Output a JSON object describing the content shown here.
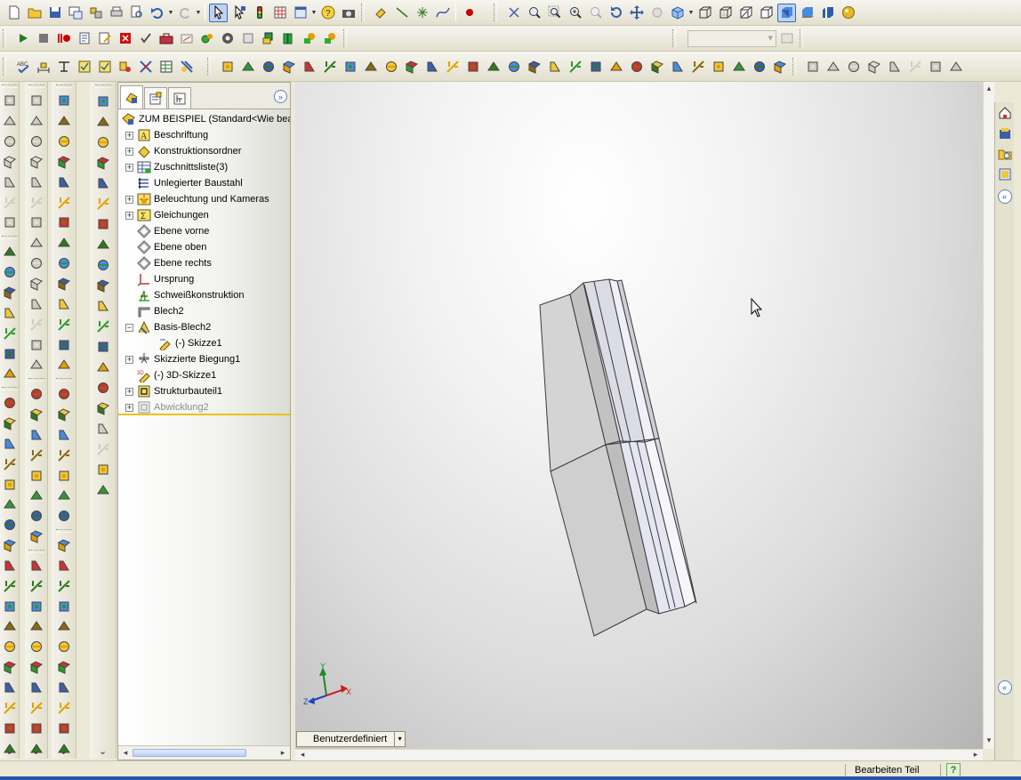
{
  "feature_tree": {
    "root": "ZUM BEISPIEL  (Standard<Wie bea",
    "items": [
      {
        "label": "Beschriftung",
        "expander": "+",
        "icon": "annotation-icon",
        "indent": 0
      },
      {
        "label": "Konstruktionsordner",
        "expander": "+",
        "icon": "design-binder-icon",
        "indent": 0
      },
      {
        "label": "Zuschnittsliste(3)",
        "expander": "+",
        "icon": "cut-list-icon",
        "indent": 0
      },
      {
        "label": "Unlegierter Baustahl",
        "expander": "",
        "icon": "material-icon",
        "indent": 0
      },
      {
        "label": "Beleuchtung und Kameras",
        "expander": "+",
        "icon": "lights-cameras-icon",
        "indent": 0
      },
      {
        "label": "Gleichungen",
        "expander": "+",
        "icon": "equations-icon",
        "indent": 0
      },
      {
        "label": "Ebene vorne",
        "expander": "",
        "icon": "plane-icon",
        "indent": 0
      },
      {
        "label": "Ebene oben",
        "expander": "",
        "icon": "plane-icon",
        "indent": 0
      },
      {
        "label": "Ebene rechts",
        "expander": "",
        "icon": "plane-icon",
        "indent": 0
      },
      {
        "label": "Ursprung",
        "expander": "",
        "icon": "origin-icon",
        "indent": 0
      },
      {
        "label": "Schweißkonstruktion",
        "expander": "",
        "icon": "weldment-icon",
        "indent": 0
      },
      {
        "label": "Blech2",
        "expander": "",
        "icon": "sheet-metal-icon",
        "indent": 0
      },
      {
        "label": "Basis-Blech2",
        "expander": "−",
        "icon": "base-flange-icon",
        "indent": 0
      },
      {
        "label": "(-) Skizze1",
        "expander": "",
        "icon": "sketch-icon",
        "indent": 1
      },
      {
        "label": "Skizzierte Biegung1",
        "expander": "+",
        "icon": "sketched-bend-icon",
        "indent": 0
      },
      {
        "label": "(-) 3D-Skizze1",
        "expander": "",
        "icon": "3d-sketch-icon",
        "indent": 0
      },
      {
        "label": "Strukturbauteil1",
        "expander": "+",
        "icon": "structural-member-icon",
        "indent": 0
      },
      {
        "label": "Abwicklung2",
        "expander": "+",
        "icon": "flat-pattern-icon",
        "indent": 0,
        "suppressed": true
      }
    ]
  },
  "viewport": {
    "configuration_tab": "Benutzerdefiniert",
    "triad": {
      "x": "X",
      "y": "Y",
      "z": "Z"
    }
  },
  "status": {
    "text": "Bearbeiten Teil",
    "help": "?"
  },
  "colors": {
    "accent": "#316ac5",
    "rollback_bar": "#e8c400",
    "model_face": "#d8d8d8",
    "model_highlight": "#e4e4f4"
  }
}
